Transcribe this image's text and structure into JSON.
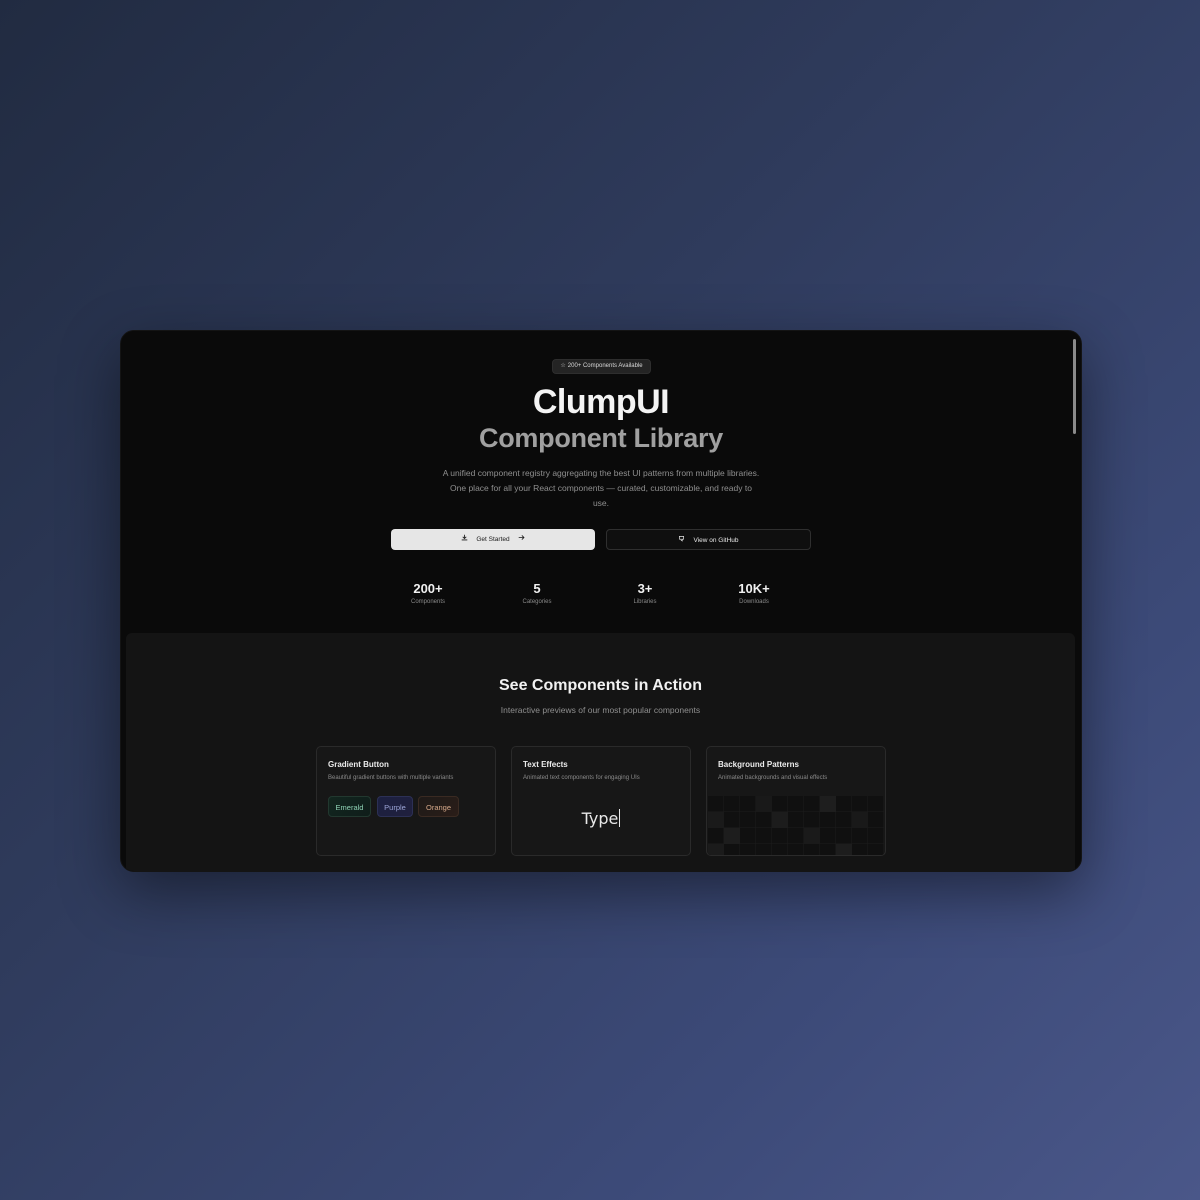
{
  "hero": {
    "badge": "200+ Components Available",
    "badge_icon": "star-icon",
    "title": "ClumpUI",
    "subtitle": "Component Library",
    "description": "A unified component registry aggregating the best UI patterns from multiple libraries. One place for all your React components — curated, customizable, and ready to use.",
    "primary_button": "Get Started",
    "secondary_button": "View on GitHub"
  },
  "stats": [
    {
      "value": "200+",
      "label": "Components"
    },
    {
      "value": "5",
      "label": "Categories"
    },
    {
      "value": "3+",
      "label": "Libraries"
    },
    {
      "value": "10K+",
      "label": "Downloads"
    }
  ],
  "showcase": {
    "title": "See Components in Action",
    "subtitle": "Interactive previews of our most popular components",
    "cards": [
      {
        "title": "Gradient Button",
        "description": "Beautiful gradient buttons with multiple variants",
        "buttons": [
          "Emerald",
          "Purple",
          "Orange"
        ]
      },
      {
        "title": "Text Effects",
        "description": "Animated text components for engaging UIs",
        "preview_text": "Type"
      },
      {
        "title": "Background Patterns",
        "description": "Animated backgrounds and visual effects"
      }
    ]
  },
  "colors": {
    "background": "#0a0a0a",
    "section": "#141414",
    "primary_button": "#e6e6e6",
    "emerald": "#8fd3b5",
    "purple": "#9da6d8",
    "orange": "#d6a98a"
  }
}
